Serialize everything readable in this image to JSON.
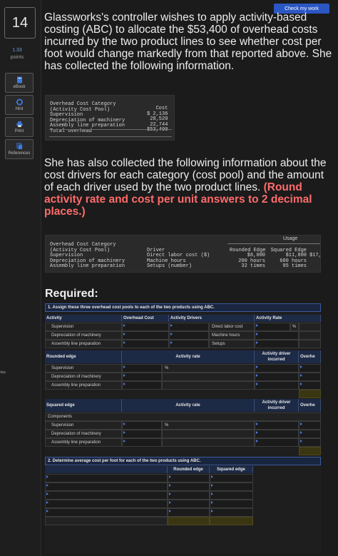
{
  "question": {
    "number": "14",
    "points_value": "1.33",
    "points_label": "points"
  },
  "tools": [
    {
      "label": "eBook",
      "icon": "book-icon"
    },
    {
      "label": "Hint",
      "icon": "lifebuoy-icon"
    },
    {
      "label": "Print",
      "icon": "printer-icon"
    },
    {
      "label": "References",
      "icon": "copy-icon"
    }
  ],
  "check_button": "Check my work",
  "paragraph1": "Glassworks's controller wishes to apply activity-based costing (ABC) to allocate the $53,400 of overhead costs incurred by the two product lines to see whether cost per foot would change markedly from that reported above. She has collected the following information.",
  "overhead_table": {
    "header_line1": "Overhead Cost Category",
    "header_line2": "(Activity Cost Pool)",
    "cost_header": "Cost",
    "rows": [
      {
        "category": "Supervision",
        "cost": "$ 2,136"
      },
      {
        "category": "Depreciation of machinery",
        "cost": "28,520"
      },
      {
        "category": "Assembly line preparation",
        "cost": "22,744"
      }
    ],
    "total_label": "Total overhead",
    "total_value": "$53,400"
  },
  "paragraph2_plain": "She has also collected the following information about the cost drivers for each category (cost pool) and the amount of each driver used by the two product lines. ",
  "paragraph2_highlight": "(Round activity rate and cost per unit answers to 2 decimal places.)",
  "driver_table": {
    "usage_label": "Usage",
    "header_line1": "Overhead Cost Category",
    "header_line2": "(Activity Cost Pool)",
    "driver_header": "Driver",
    "rounded_header": "Rounded Edge",
    "squared_header": "Squared Edge",
    "extra_header": "",
    "rows": [
      {
        "category": "Supervision",
        "driver": "Direct labor cost ($)",
        "rounded": "$6,000",
        "squared": "$11,800",
        "extra": "$17,"
      },
      {
        "category": "Depreciation of machinery",
        "driver": "Machine hours",
        "rounded": "200 hours",
        "squared": "600 hours",
        "extra": ""
      },
      {
        "category": "Assembly line preparation",
        "driver": "Setups (number)",
        "rounded": "32 times",
        "squared": "95 times",
        "extra": ""
      }
    ]
  },
  "required_label": "Required:",
  "part1": {
    "title": "1. Assign these three overhead cost pools to each of the two products using ABC.",
    "headers": {
      "activity": "Activity",
      "overhead_cost": "Overhead Cost",
      "activity_drivers": "Activity Drivers",
      "activity_rate": "Activity Rate"
    },
    "activities": [
      "Supervision",
      "Depreciation of machinery",
      "Assembly line preparation"
    ],
    "drivers": [
      "Direct labor cost",
      "Machine hours",
      "Setups"
    ],
    "pct_symbol": "%",
    "rounded": {
      "title": "Rounded edge",
      "rate": "Activity rate",
      "driver_incurred": "Activity driver incurred",
      "overhead": "Overhe"
    },
    "squared": {
      "title": "Squared edge",
      "rate": "Activity rate",
      "driver_incurred": "Activity driver incurred",
      "overhead": "Overhe",
      "components": "Components"
    }
  },
  "part2": {
    "title": "2. Determine average cost per foot for each of the two products using ABC.",
    "rounded": "Rounded edge",
    "squared": "Squared edge"
  }
}
